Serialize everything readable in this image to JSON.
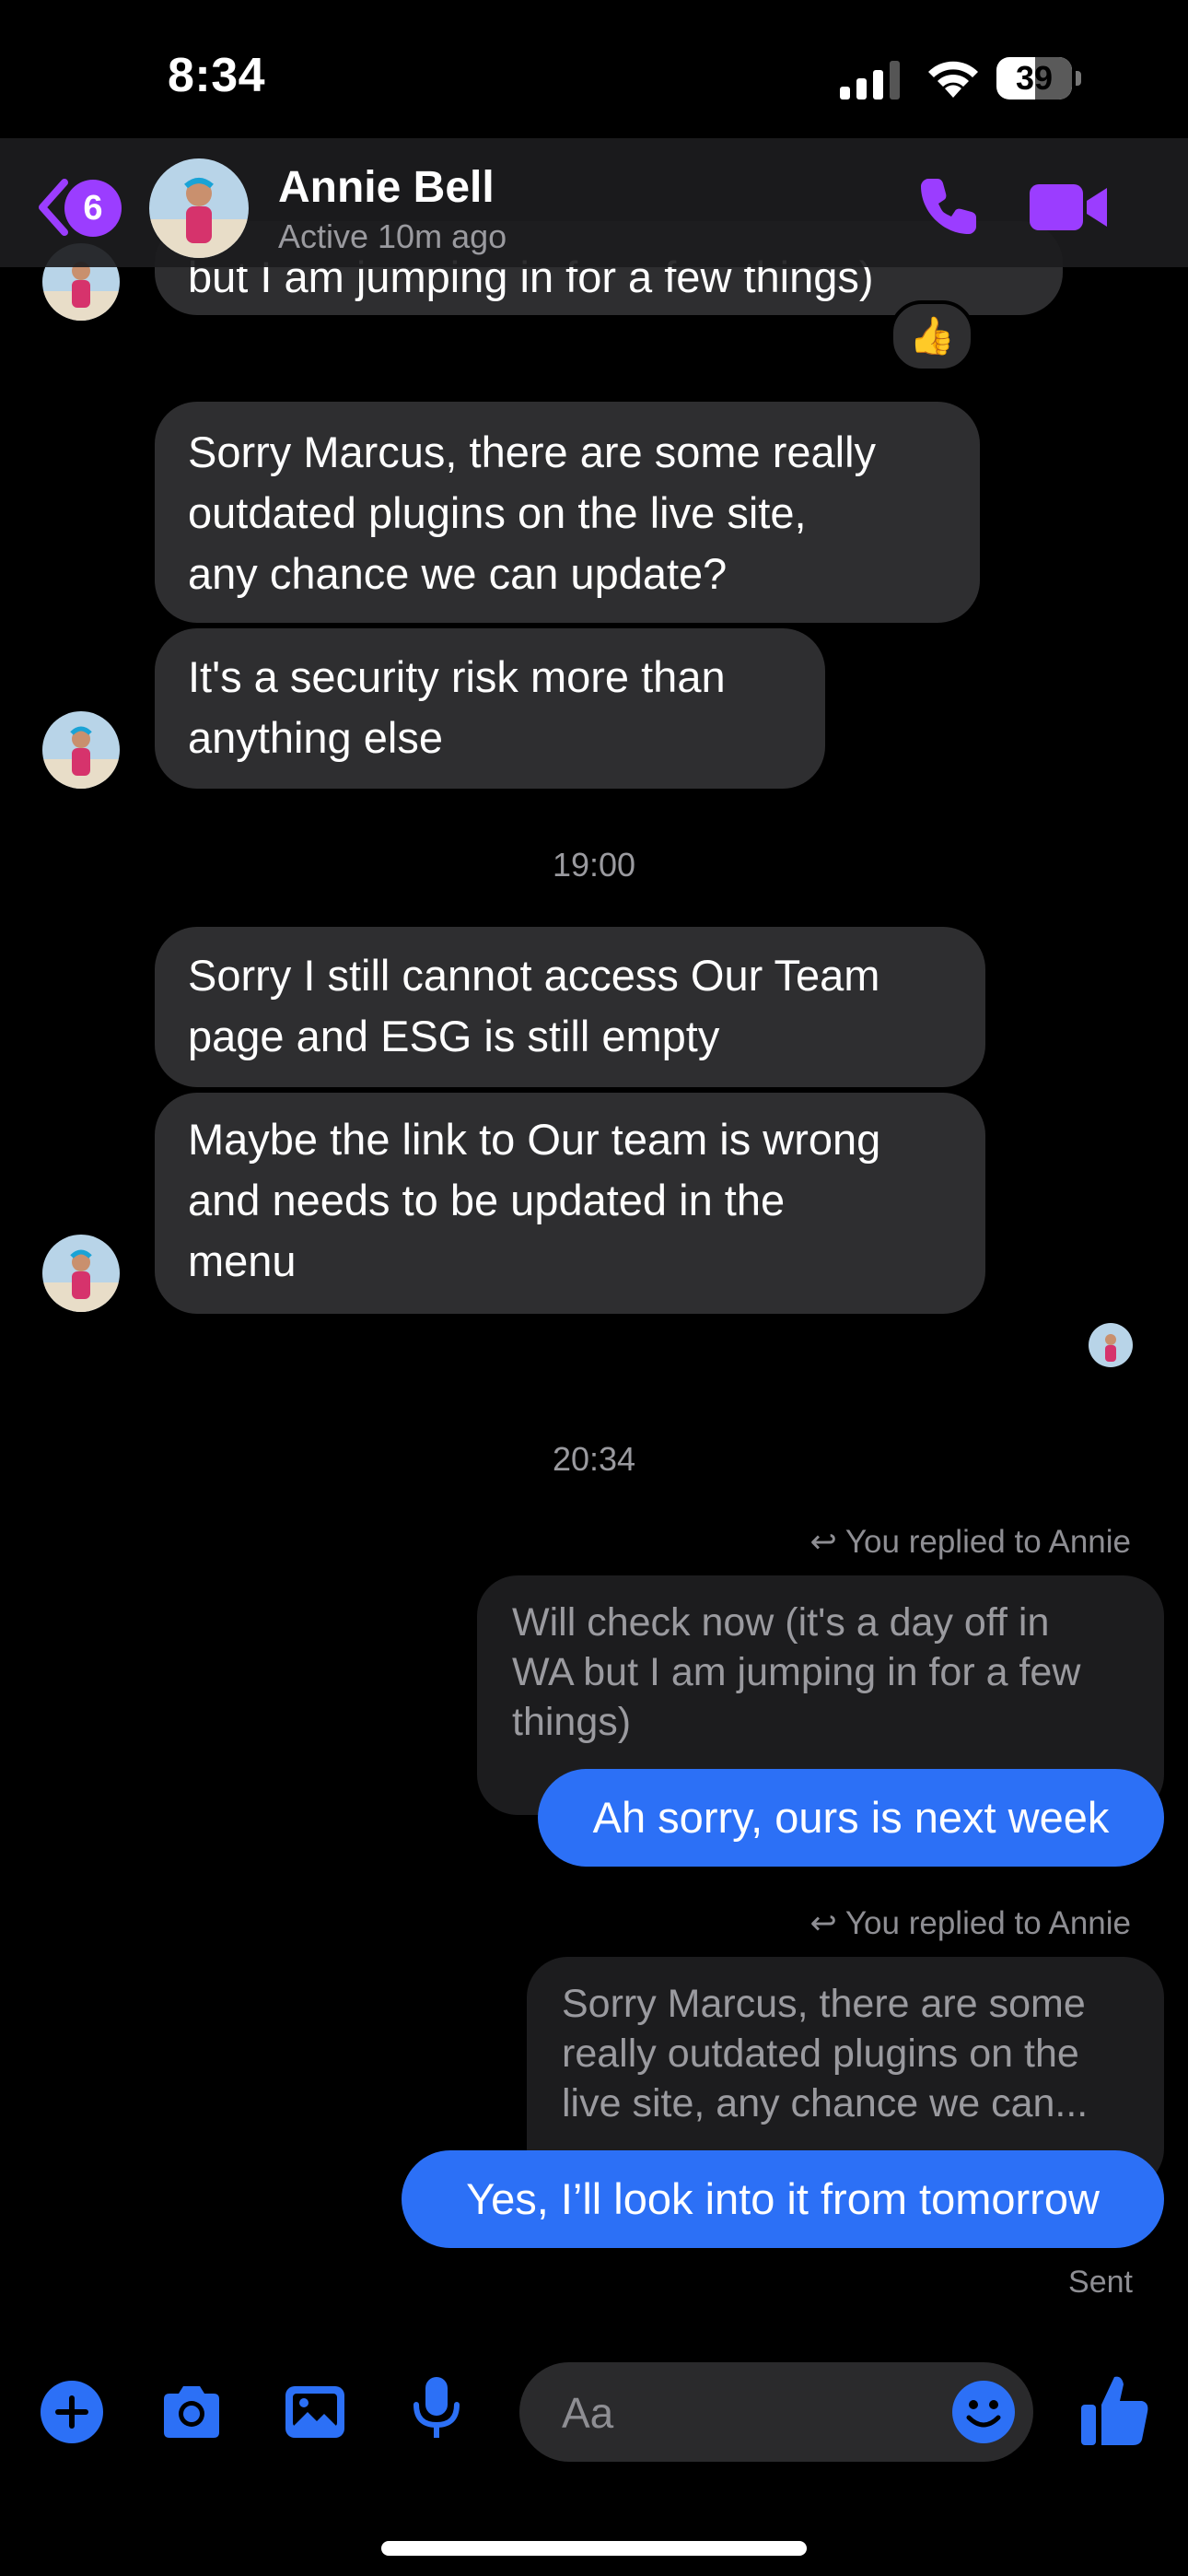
{
  "status_bar": {
    "time": "8:34",
    "battery": "39"
  },
  "header": {
    "back_badge": "6",
    "contact_name": "Annie Bell",
    "contact_status": "Active 10m ago"
  },
  "messages": {
    "partial_top": "but I am jumping in for a few things)",
    "partial_reaction": "👍",
    "group1": [
      [
        "Sorry Marcus, there are some really",
        "outdated plugins on the live site,",
        "any chance we can update?"
      ],
      [
        "It's a security risk more than",
        "anything else"
      ]
    ],
    "time1": "19:00",
    "group2": [
      [
        "Sorry I still cannot access Our Team",
        "page and ESG is still empty"
      ],
      [
        "Maybe the link to Our team is wrong",
        "and needs to be updated in the",
        "menu"
      ]
    ],
    "time2": "20:34",
    "reply1": {
      "note": "You replied to Annie",
      "quoted": [
        "Will check now (it's a day off in",
        "WA but I am jumping in for a few",
        "things)"
      ],
      "text": "Ah sorry, ours is next week"
    },
    "reply2": {
      "note": "You replied to Annie",
      "quoted": [
        "Sorry Marcus, there are some",
        "really outdated plugins on the",
        "live site, any chance we can..."
      ],
      "text": "Yes, I’ll look into it from tomorrow"
    },
    "sent_status": "Sent"
  },
  "composer": {
    "placeholder": "Aa"
  },
  "colors": {
    "accent": "#9b3dff",
    "outgoing": "#2c70f6",
    "incoming": "#2e2e30"
  },
  "icons": [
    "chevron-left-icon",
    "phone-icon",
    "video-icon",
    "plus-icon",
    "camera-icon",
    "gallery-icon",
    "microphone-icon",
    "emoji-icon",
    "thumbs-up-icon"
  ]
}
